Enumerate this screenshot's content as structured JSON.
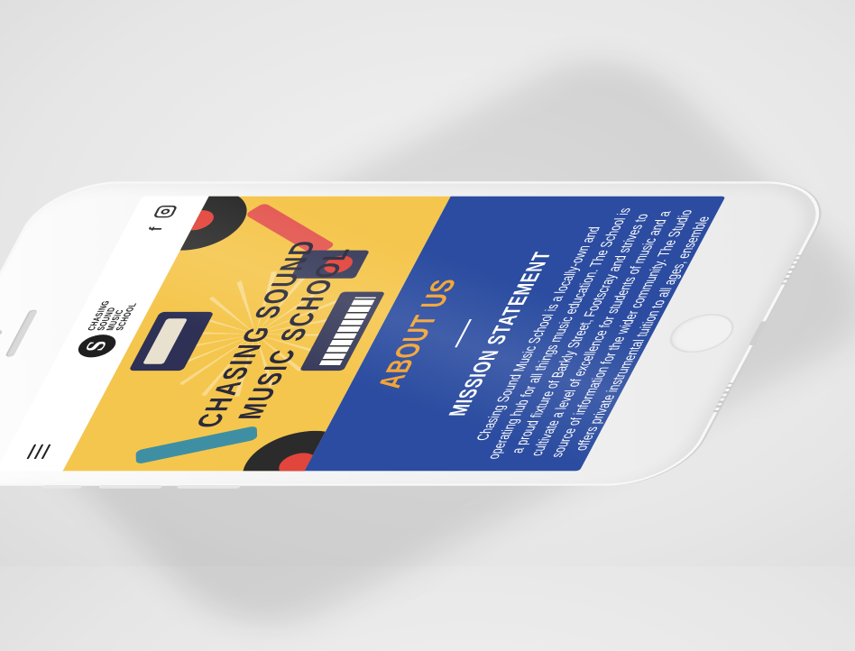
{
  "header": {
    "menu_icon": "hamburger-menu-icon",
    "logo": {
      "line1": "CHASING",
      "line2": "SOUND",
      "line3": "MUSIC",
      "line4": "SCHOOL"
    },
    "social": {
      "facebook_icon": "facebook-icon",
      "facebook_glyph": "f",
      "instagram_icon": "instagram-icon"
    }
  },
  "hero": {
    "title_line1": "CHASING SOUND",
    "title_line2": "MUSIC SCHOOL"
  },
  "about": {
    "heading": "ABOUT US",
    "subheading": "MISSION STATEMENT",
    "body": "Chasing Sound Music School is a locally-own and operating hub for all things music education. The School is a proud fixture of Barkly Street, Footscray and strives to cultivate a level of excellence for students of music and a source of information for the wider community. The Studio offers private instrumental tuition to all ages, ensemble pathways and group classes aimed at"
  },
  "colors": {
    "hero_bg": "#f5c64d",
    "about_bg": "#2b4ca0",
    "accent": "#f3a332",
    "text_dark": "#2b2a3c"
  }
}
